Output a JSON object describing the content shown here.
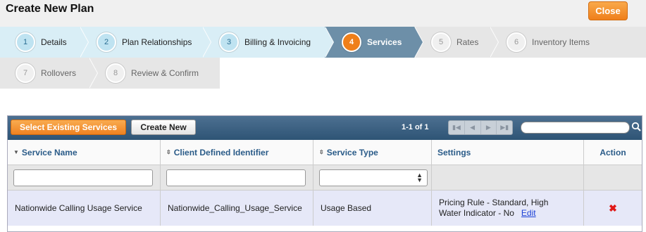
{
  "header": {
    "title": "Create New Plan",
    "close_label": "Close"
  },
  "wizard": {
    "steps": [
      {
        "num": "1",
        "label": "Details",
        "state": "done"
      },
      {
        "num": "2",
        "label": "Plan Relationships",
        "state": "done"
      },
      {
        "num": "3",
        "label": "Billing & Invoicing",
        "state": "done"
      },
      {
        "num": "4",
        "label": "Services",
        "state": "active"
      },
      {
        "num": "5",
        "label": "Rates",
        "state": "future"
      },
      {
        "num": "6",
        "label": "Inventory Items",
        "state": "future"
      },
      {
        "num": "7",
        "label": "Rollovers",
        "state": "future"
      },
      {
        "num": "8",
        "label": "Review & Confirm",
        "state": "future"
      }
    ]
  },
  "toolbar": {
    "select_existing_label": "Select Existing Services",
    "create_new_label": "Create New",
    "pager_text": "1-1 of 1"
  },
  "table": {
    "columns": [
      "Service Name",
      "Client Defined Identifier",
      "Service Type",
      "Settings",
      "Action"
    ],
    "rows": [
      {
        "service_name": "Nationwide Calling Usage Service",
        "client_identifier": "Nationwide_Calling_Usage_Service",
        "service_type": "Usage Based",
        "settings_line1": "Pricing Rule - Standard, High",
        "settings_line2": "Water Indicator - No",
        "edit_label": "Edit"
      }
    ]
  },
  "colors": {
    "accent_orange": "#ef7f1a",
    "header_blue": "#2e5475",
    "link_blue": "#1a3fd6",
    "delete_red": "#e01818"
  }
}
